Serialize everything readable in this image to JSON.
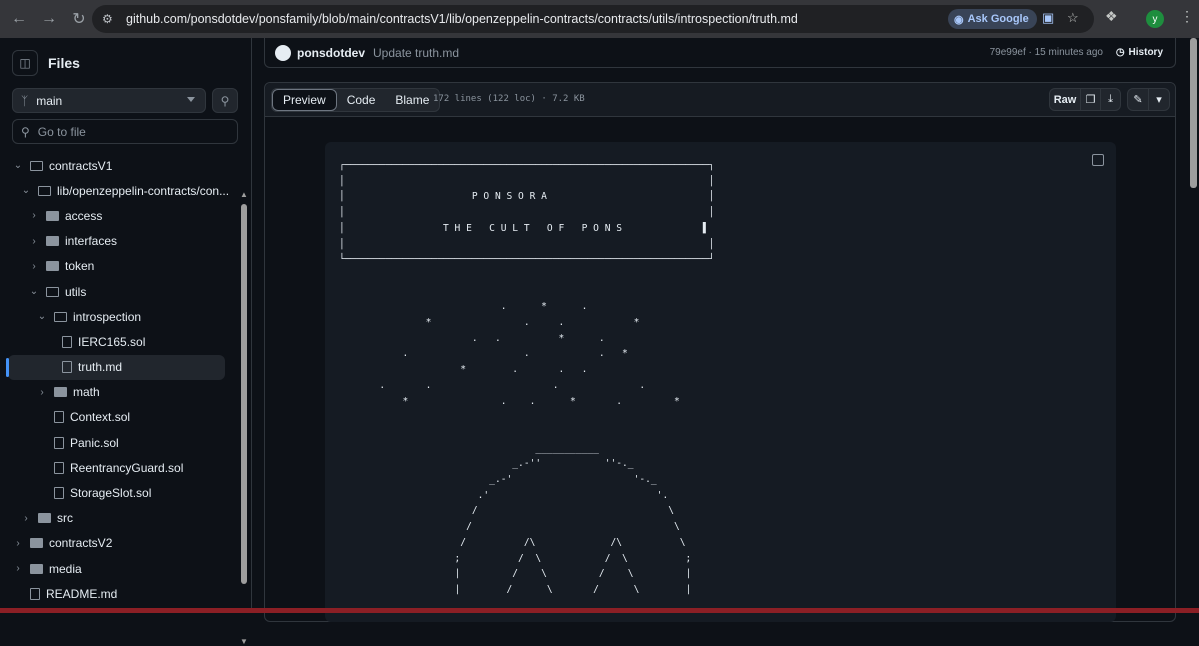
{
  "browser": {
    "url": "github.com/ponsdotdev/ponsfamily/blob/main/contractsV1/lib/openzeppelin-contracts/contracts/utils/introspection/truth.md",
    "ask_google_label": "Ask Google",
    "avatar_letter": "y"
  },
  "sidebar": {
    "title": "Files",
    "branch": "main",
    "goto_placeholder": "Go to file",
    "tree": [
      {
        "label": "contractsV1",
        "kind": "folder-open",
        "depth": 0
      },
      {
        "label": "lib/openzeppelin-contracts/con...",
        "kind": "folder-open",
        "depth": 1
      },
      {
        "label": "access",
        "kind": "folder",
        "depth": 2
      },
      {
        "label": "interfaces",
        "kind": "folder",
        "depth": 2
      },
      {
        "label": "token",
        "kind": "folder",
        "depth": 2
      },
      {
        "label": "utils",
        "kind": "folder-open",
        "depth": 2
      },
      {
        "label": "introspection",
        "kind": "folder-open",
        "depth": 3
      },
      {
        "label": "IERC165.sol",
        "kind": "file",
        "depth": 4
      },
      {
        "label": "truth.md",
        "kind": "file",
        "depth": 4,
        "active": true
      },
      {
        "label": "math",
        "kind": "folder",
        "depth": 3
      },
      {
        "label": "Context.sol",
        "kind": "file",
        "depth": 3
      },
      {
        "label": "Panic.sol",
        "kind": "file",
        "depth": 3
      },
      {
        "label": "ReentrancyGuard.sol",
        "kind": "file",
        "depth": 3
      },
      {
        "label": "StorageSlot.sol",
        "kind": "file",
        "depth": 3
      },
      {
        "label": "src",
        "kind": "folder",
        "depth": 1
      },
      {
        "label": "contractsV2",
        "kind": "folder",
        "depth": 0
      },
      {
        "label": "media",
        "kind": "folder",
        "depth": 0
      },
      {
        "label": "README.md",
        "kind": "file",
        "depth": 0
      }
    ]
  },
  "commit": {
    "author": "ponsdotdev",
    "message": "Update truth.md",
    "meta": "79e99ef · 15 minutes ago",
    "history_label": "History"
  },
  "file": {
    "tabs": [
      "Preview",
      "Code",
      "Blame"
    ],
    "active_tab": "Preview",
    "info": "172 lines (122 loc) · 7.2 KB",
    "raw_label": "Raw"
  },
  "content_lines": [
    "┌───────────────────────────────────────────────────────────────┐",
    "│                                                               │",
    "│                      P O N S O R A                            │",
    "│                                                               │",
    "│                 T H E   C U L T   O F   P O N S              ▌",
    "│                                                               │",
    "└───────────────────────────────────────────────────────────────┘",
    "",
    "",
    "                            .      *      .",
    "               *                .     .            *",
    "                       .   .          *      .",
    "           .                    .            .   *",
    "                     *        .       .   .",
    "       .       .                     .              .",
    "           *                .    .      *       .         *",
    "",
    "",
    "                                  ___________",
    "                              _.-''           ''-._",
    "                          _.-'                     '-._",
    "                        .'                             '.",
    "                       /                                 \\",
    "                      /                                   \\",
    "                     /          /\\             /\\          \\",
    "                    ;          /  \\           /  \\          ;",
    "                    |         /    \\         /    \\         |",
    "                    |        /      \\       /      \\        |"
  ]
}
